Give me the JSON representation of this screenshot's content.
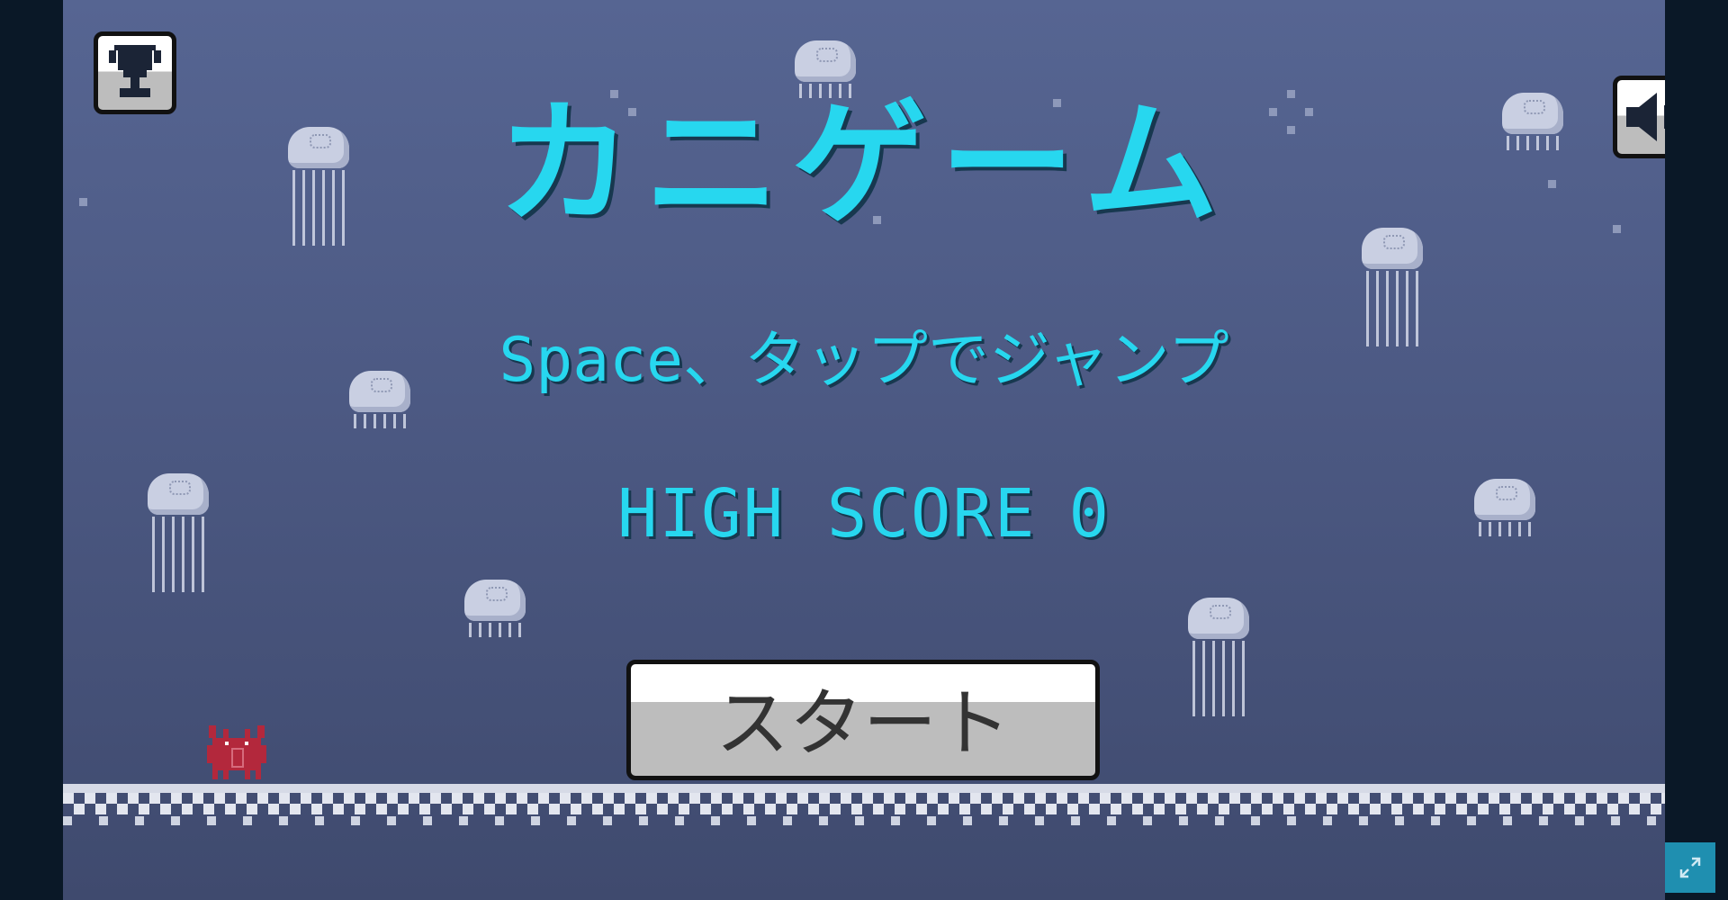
{
  "game": {
    "title": "カニゲーム",
    "instruction": "Space、タップでジャンプ",
    "high_score_label": "HIGH SCORE",
    "high_score_value": "0",
    "start_label": "スタート"
  },
  "colors": {
    "title_text": "#27d7ef",
    "background_top": "#566592",
    "background_bottom": "#3f4a6e",
    "side_panel": "#0a1827",
    "expand_button": "#1f8fb0",
    "crab": "#b3283c"
  },
  "icons": {
    "leaderboard": "trophy-icon",
    "sound": "speaker-icon",
    "fullscreen": "expand-icon"
  }
}
